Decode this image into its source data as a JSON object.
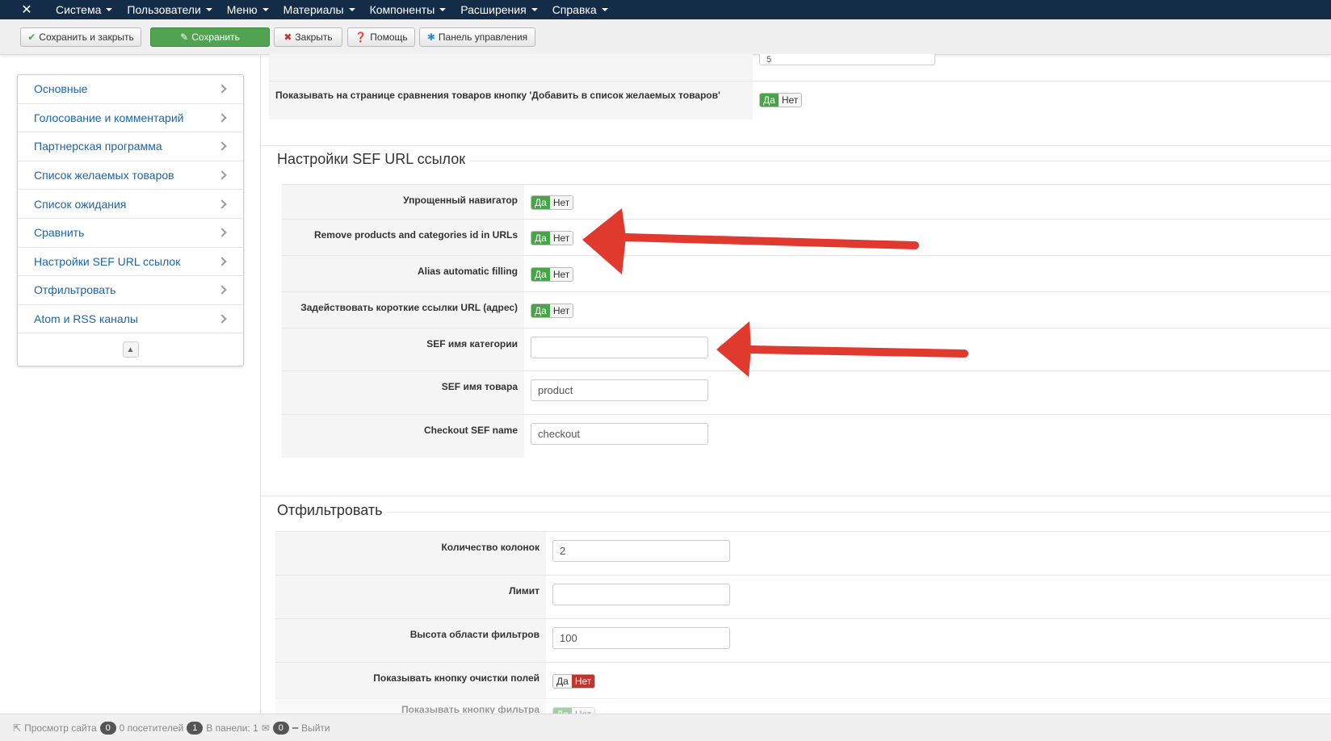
{
  "topnav": {
    "logo_icon": "joomla-icon",
    "items": [
      "Система",
      "Пользователи",
      "Меню",
      "Материалы",
      "Компоненты",
      "Расширения",
      "Справка"
    ]
  },
  "toolbar": {
    "save_close": "Сохранить и закрыть",
    "save": "Сохранить",
    "close": "Закрыть",
    "help": "Помощь",
    "control_panel": "Панель управления"
  },
  "sidebar": {
    "items": [
      "Основные",
      "Голосование и комментарий",
      "Партнерская программа",
      "Список желаемых товаров",
      "Список ожидания",
      "Сравнить",
      "Настройки SEF URL ссылок",
      "Отфильтровать",
      "Atom и RSS каналы"
    ]
  },
  "top_section": {
    "partial_value": "5",
    "compare_wishlist_label": "Показывать на странице сравнения товаров кнопку 'Добавить в список желаемых товаров'"
  },
  "toggle": {
    "yes": "Да",
    "no": "Нет"
  },
  "sef_section": {
    "title": "Настройки SEF URL ссылок",
    "simple_nav": "Упрощенный навигатор",
    "remove_ids": "Remove products and categories id in URLs",
    "alias_auto": "Alias automatic filling",
    "short_urls": "Задействовать короткие ссылки URL (адрес)",
    "category_name": "SEF имя категории",
    "category_value": "",
    "product_name": "SEF имя товара",
    "product_value": "product",
    "checkout_name": "Checkout SEF name",
    "checkout_value": "checkout"
  },
  "filter_section": {
    "title": "Отфильтровать",
    "columns_label": "Количество колонок",
    "columns_value": "2",
    "limit_label": "Лимит",
    "limit_value": "",
    "height_label": "Высота области фильтров",
    "height_value": "100",
    "clear_btn_label": "Показывать кнопку очистки полей",
    "filter_btn_label": "Показывать кнопку фильтра"
  },
  "footer": {
    "view_site": "Просмотр сайта",
    "visitors_count": "0",
    "visitors_label": "0 посетителей",
    "panel_count": "1",
    "panel_label": "В панели: 1",
    "msg_count": "0",
    "logout": "Выйти"
  },
  "colors": {
    "topbar": "#132c47",
    "green": "#46a546",
    "red": "#bd362f",
    "link": "#1b65a6",
    "arrow": "#e03a2f"
  }
}
